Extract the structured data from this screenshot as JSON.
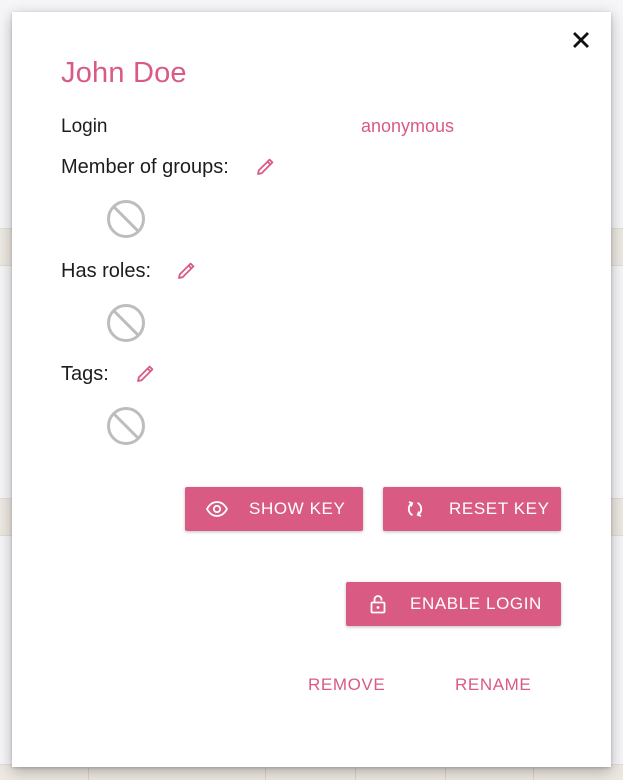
{
  "modal": {
    "close_icon": "close-icon",
    "title": "John Doe",
    "login": {
      "label": "Login",
      "value": "anonymous"
    },
    "sections": [
      {
        "label": "Member of groups:",
        "edit_icon": "pencil-icon",
        "empty_icon": "no-entry-icon"
      },
      {
        "label": "Has roles:",
        "edit_icon": "pencil-icon",
        "empty_icon": "no-entry-icon"
      },
      {
        "label": "Tags:",
        "edit_icon": "pencil-icon",
        "empty_icon": "no-entry-icon"
      }
    ],
    "buttons": {
      "show_key": "SHOW KEY",
      "reset_key": "RESET KEY",
      "enable_login": "ENABLE LOGIN",
      "remove": "REMOVE",
      "rename": "RENAME"
    }
  },
  "colors": {
    "accent": "#d95b83",
    "text": "#1d1d1f",
    "icon_gray": "#bdbdbd",
    "backdrop": "#ebebee"
  }
}
